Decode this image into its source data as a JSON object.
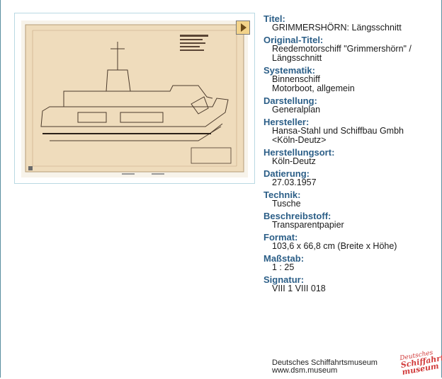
{
  "record": {
    "fields": [
      {
        "label": "Titel:",
        "values": [
          "GRIMMERSHÖRN: Längsschnitt"
        ]
      },
      {
        "label": "Original-Titel:",
        "values": [
          "Reedemotorschiff \"Grimmershörn\" /",
          "Längsschnitt"
        ]
      },
      {
        "label": "Systematik:",
        "values": [
          "Binnenschiff",
          "Motorboot, allgemein"
        ]
      },
      {
        "label": "Darstellung:",
        "values": [
          "Generalplan"
        ]
      },
      {
        "label": "Hersteller:",
        "values": [
          "Hansa-Stahl und Schiffbau Gmbh",
          "<Köln-Deutz>"
        ]
      },
      {
        "label": "Herstellungsort:",
        "values": [
          "Köln-Deutz"
        ]
      },
      {
        "label": "Datierung:",
        "values": [
          "27.03.1957"
        ]
      },
      {
        "label": "Technik:",
        "values": [
          "Tusche"
        ]
      },
      {
        "label": "Beschreibstoff:",
        "values": [
          "Transparentpapier"
        ]
      },
      {
        "label": "Format:",
        "values": [
          "103,6 x 66,8 cm (Breite x Höhe)"
        ]
      },
      {
        "label": "Maßstab:",
        "values": [
          "1 : 25"
        ]
      },
      {
        "label": "Signatur:",
        "values": [
          "VIII 1 VIII 018"
        ]
      }
    ]
  },
  "footer": {
    "museum_name": "Deutsches Schiffahrtsmuseum",
    "url": "www.dsm.museum"
  },
  "logo": {
    "line1": "Deutsches",
    "line2": "Schiffahrts",
    "line3": "museum",
    "color": "#d13a3a"
  },
  "viewer": {
    "play_icon": "play-triangle-icon",
    "accent": "#f3d38a"
  }
}
